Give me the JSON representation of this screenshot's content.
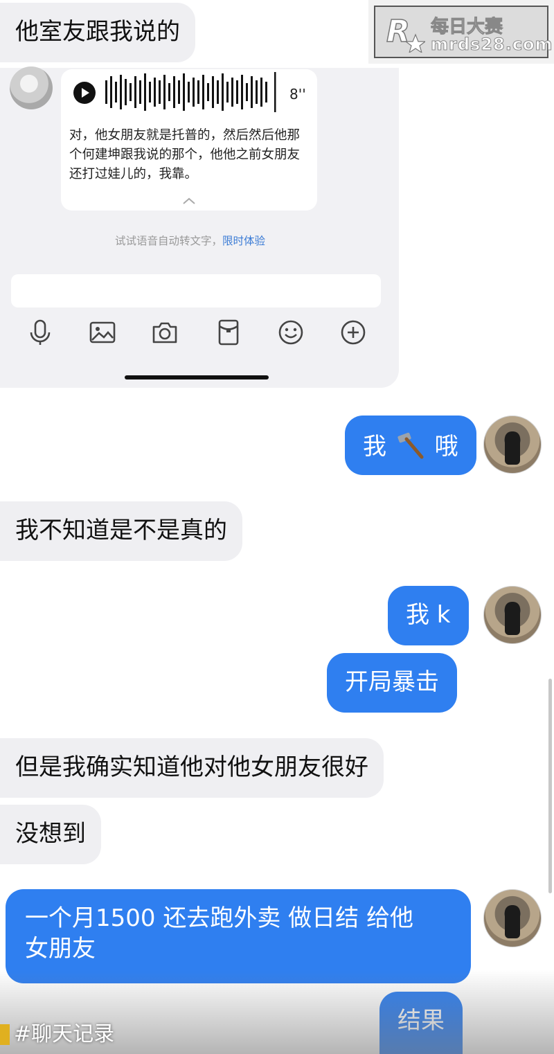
{
  "watermark": {
    "title": "每日大赛",
    "url": "mrds28.com",
    "logo_letter": "R"
  },
  "messages": {
    "m1": "他室友跟我说的",
    "m2_part1": "我",
    "m2_part2": "哦",
    "m3": "我不知道是不是真的",
    "m4": "我 k",
    "m5": "开局暴击",
    "m6": "但是我确实知道他对他女朋友很好",
    "m7": "没想到",
    "m8_line1": "一个月1500 还去跑外卖 做日结 给他",
    "m8_line2": "女朋友",
    "m9": "结果"
  },
  "voice": {
    "duration": "8''",
    "transcript": "对，他女朋友就是托普的，然后然后他那个何建坤跟我说的那个，他他之前女朋友还打过娃儿的，我靠。",
    "collapse_icon": "chevron-up-icon",
    "hint": "试试语音自动转文字，",
    "hint_link": "限时体验"
  },
  "toolbar": {
    "icons": [
      "microphone-icon",
      "image-icon",
      "camera-icon",
      "red-packet-icon",
      "emoji-icon",
      "plus-icon"
    ]
  },
  "hashtag": "#聊天记录",
  "colors": {
    "out_bubble": "#2f7ff0",
    "in_bubble": "#efeff2",
    "link": "#3a7bd5"
  }
}
